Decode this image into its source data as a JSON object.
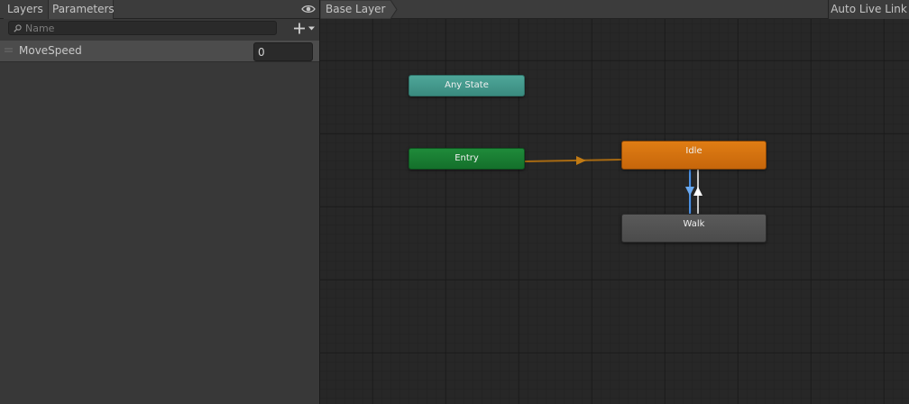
{
  "left_panel": {
    "tabs": {
      "layers": "Layers",
      "parameters": "Parameters"
    },
    "visibility_icon": "eye-icon",
    "search": {
      "placeholder": "Name",
      "value": "",
      "icon": "search-icon"
    },
    "add_button_icon": "plus-dropdown-icon",
    "parameters": [
      {
        "name": "MoveSpeed",
        "value": "0"
      }
    ]
  },
  "graph": {
    "breadcrumb": "Base Layer",
    "auto_live_link": "Auto Live Link",
    "nodes": {
      "any_state": "Any State",
      "entry": "Entry",
      "idle": "Idle",
      "walk": "Walk"
    },
    "transitions": [
      {
        "from": "Entry",
        "to": "Idle",
        "color": "#a86a12"
      },
      {
        "from": "Idle",
        "to": "Walk",
        "color": "#4a90e2"
      },
      {
        "from": "Walk",
        "to": "Idle",
        "color": "#ffffff"
      }
    ]
  },
  "colors": {
    "any_state": "#45998c",
    "entry": "#1a7d33",
    "idle": "#d57110",
    "walk": "#525252",
    "graph_background": "#272727",
    "panel_background": "#383838"
  }
}
